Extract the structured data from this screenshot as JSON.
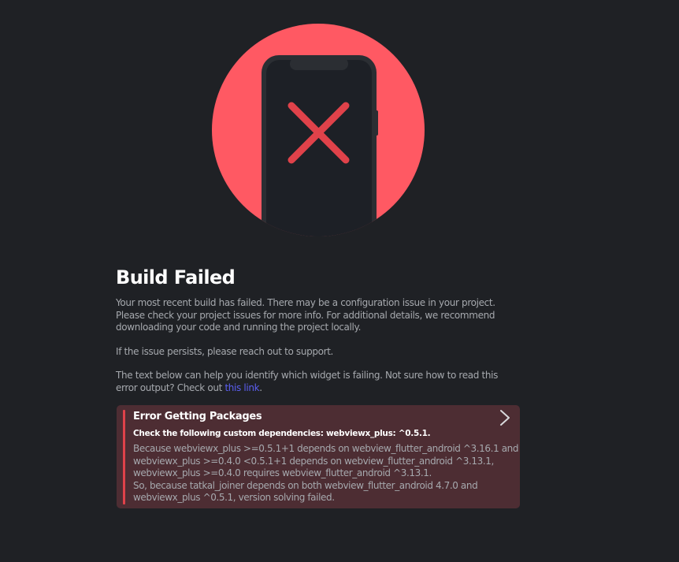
{
  "status": {
    "title": "Build Failed",
    "paragraph1": "Your most recent build has failed. There may be a configuration issue in your project. Please check your project issues for more info. For additional details, we recommend downloading your code and running the project locally.",
    "paragraph2": "If the issue persists, please reach out to support.",
    "paragraph3_prefix": "The text below can help you identify which widget is failing. Not sure how to read this error output? Check out ",
    "paragraph3_link": "this link",
    "paragraph3_suffix": "."
  },
  "error": {
    "title": "Error Getting Packages",
    "subtitle": "Check the following custom dependencies: webviewx_plus: ^0.5.1.",
    "lines": [
      "Because webviewx_plus >=0.5.1+1 depends on webview_flutter_android ^3.16.1 and",
      "webviewx_plus >=0.4.0 <0.5.1+1 depends on webview_flutter_android ^3.13.1,",
      "webviewx_plus >=0.4.0 requires webview_flutter_android ^3.13.1.",
      "So, because tatkal_joiner depends on both webview_flutter_android 4.7.0 and",
      "webviewx_plus ^0.5.1, version solving failed."
    ]
  },
  "colors": {
    "background": "#1f2125",
    "circle": "#ff5963",
    "phone": "#1d2026",
    "cross": "#e0424a",
    "link": "#5b5ef0",
    "error_card": "#4d2d33"
  },
  "icons": {
    "illustration": "phone-error-icon",
    "cross": "x-mark-icon",
    "expand": "chevron-right-icon"
  }
}
